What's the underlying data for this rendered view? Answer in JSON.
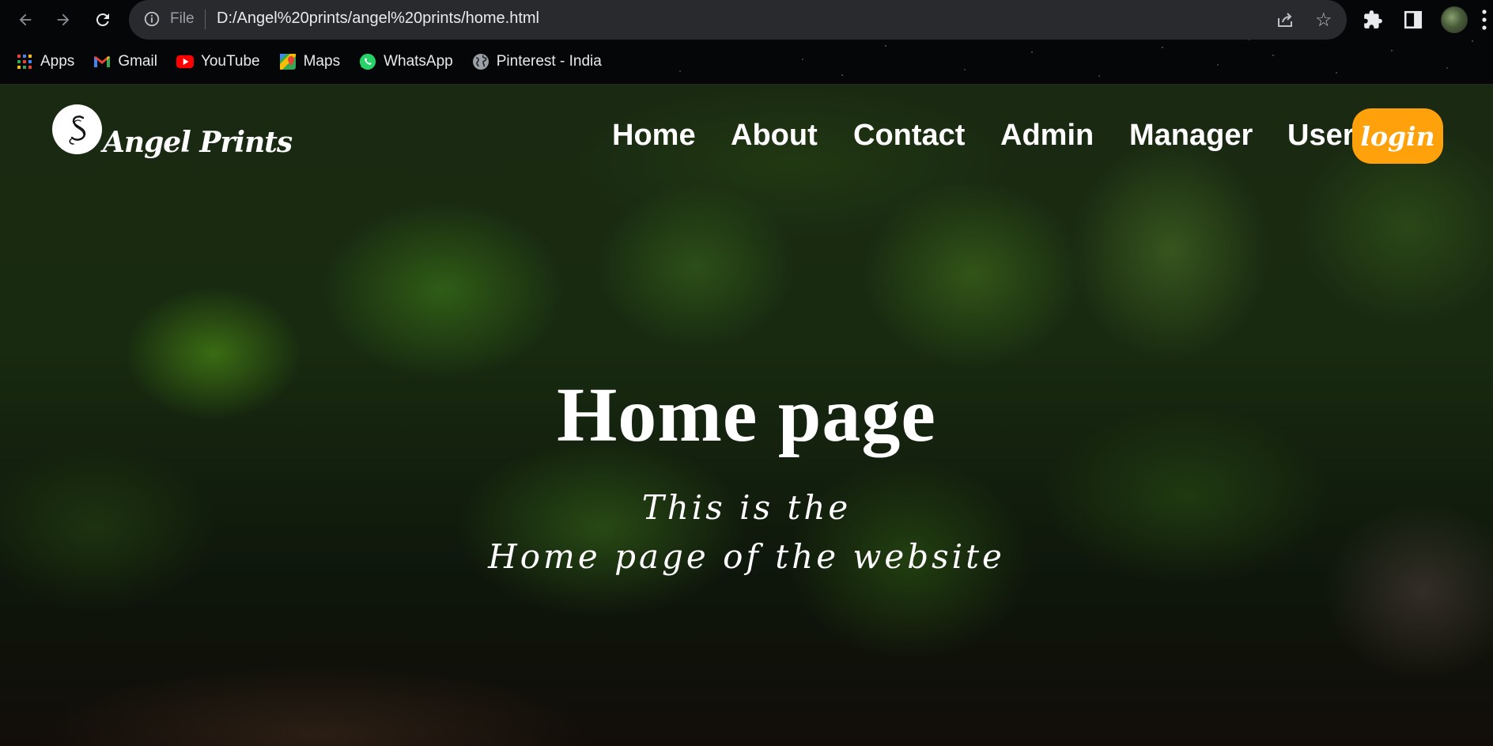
{
  "browser": {
    "omnibox": {
      "scheme_label": "File",
      "url": "D:/Angel%20prints/angel%20prints/home.html"
    },
    "bookmarks": [
      {
        "label": "Apps",
        "icon": "apps-grid-icon"
      },
      {
        "label": "Gmail",
        "icon": "gmail-icon"
      },
      {
        "label": "YouTube",
        "icon": "youtube-icon"
      },
      {
        "label": "Maps",
        "icon": "maps-icon"
      },
      {
        "label": "WhatsApp",
        "icon": "whatsapp-icon"
      },
      {
        "label": "Pinterest - India",
        "icon": "globe-icon"
      }
    ]
  },
  "site": {
    "brand": "Angel Prints",
    "nav": [
      "Home",
      "About",
      "Contact",
      "Admin",
      "Manager",
      "User"
    ],
    "login_label": "login",
    "accent_color": "#ffa10a"
  },
  "hero": {
    "title": "Home page",
    "subtitle_line1": "This is the",
    "subtitle_line2": "Home page of the website"
  }
}
